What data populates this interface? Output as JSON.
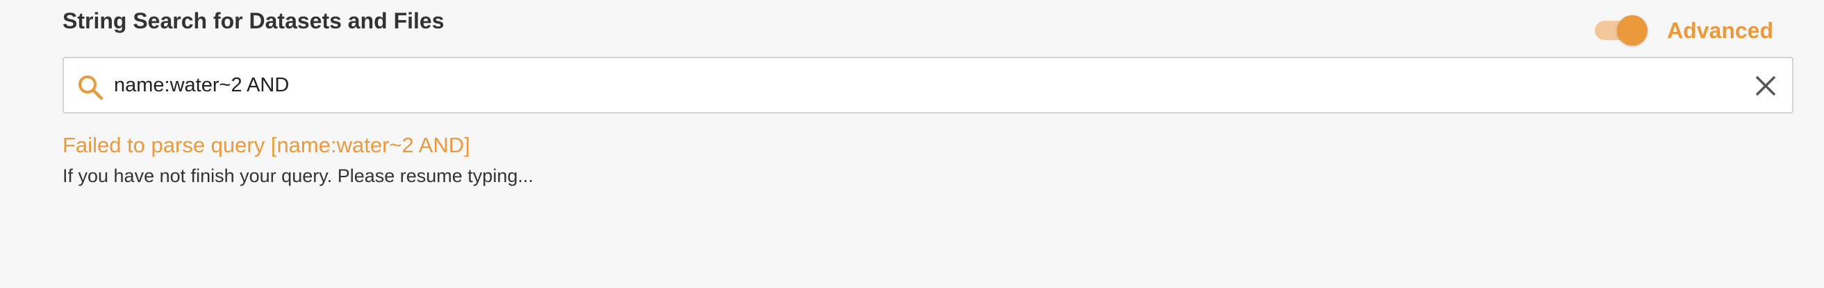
{
  "header": {
    "title": "String Search for Datasets and Files"
  },
  "advanced_toggle": {
    "label": "Advanced",
    "checked": true,
    "accent_color": "#eb9a3b"
  },
  "search": {
    "value": "name:water~2 AND",
    "icon": "search-icon",
    "clear_icon": "close-icon"
  },
  "messages": {
    "error": "Failed to parse query [name:water~2 AND]",
    "hint": "If you have not finish your query. Please resume typing..."
  }
}
